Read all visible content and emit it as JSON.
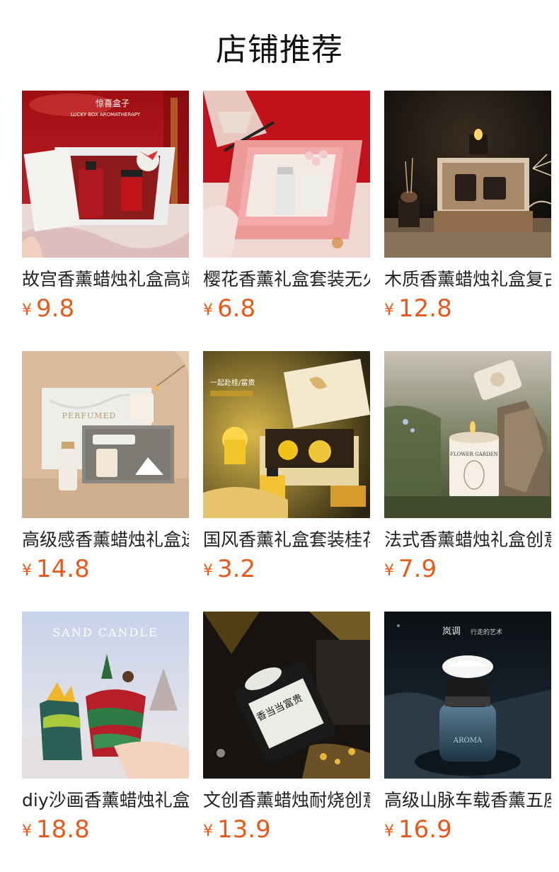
{
  "title": "店铺推荐",
  "currency_symbol": "¥",
  "products": [
    {
      "name": "故宫香薰蜡烛礼盒高端",
      "price": "9.8",
      "image": "red-gift-box-candle",
      "image_text_1": "惊喜盒子",
      "image_text_2": "LUCKY BOX AROMATHERAPY"
    },
    {
      "name": "樱花香薰礼盒套装无火",
      "price": "6.8",
      "image": "pink-gift-box-aroma"
    },
    {
      "name": "木质香薰蜡烛礼盒复古",
      "price": "12.8",
      "image": "wooden-gift-box-candle"
    },
    {
      "name": "高级感香薰蜡烛礼盒送",
      "price": "14.8",
      "image": "perfumed-gift-box",
      "image_text_1": "PERFUMED"
    },
    {
      "name": "国风香薰礼盒套装桂花",
      "price": "3.2",
      "image": "osmanthus-gift-box",
      "image_text_1": "一起赴桂/富贵"
    },
    {
      "name": "法式香薰蜡烛礼盒创意",
      "price": "7.9",
      "image": "flower-garden-candle",
      "image_text_1": "FLOWER GARDEN"
    },
    {
      "name": "diy沙画香薰蜡烛礼盒",
      "price": "18.8",
      "image": "sand-candle-diy",
      "image_text_1": "SAND CANDLE"
    },
    {
      "name": "文创香薰蜡烛耐烧创意",
      "price": "13.9",
      "image": "cultural-candle-jar",
      "image_text_1": "香当当富贵"
    },
    {
      "name": "高级山脉车载香薰五座",
      "price": "16.9",
      "image": "car-aroma-diffuser",
      "image_text_1": "岚调",
      "image_text_2": "行走的艺术",
      "image_text_3": "AROMA"
    }
  ],
  "colors": {
    "price": "#e85a1c",
    "text": "#222222",
    "background": "#ffffff"
  }
}
